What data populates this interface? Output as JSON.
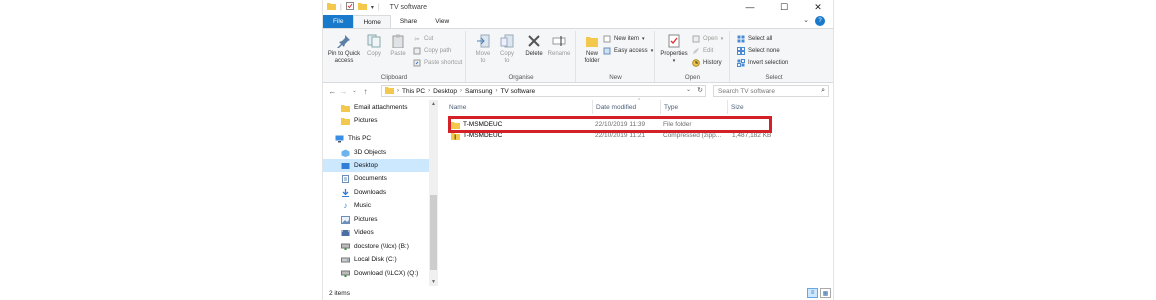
{
  "window": {
    "title": "TV software",
    "controls": {
      "minimize": "—",
      "maximize": "☐",
      "close": "✕"
    }
  },
  "ribbon_tabs": [
    "File",
    "Home",
    "Share",
    "View"
  ],
  "ribbon": {
    "clipboard": {
      "label": "Clipboard",
      "pin": "Pin to Quick access",
      "copy": "Copy",
      "paste": "Paste",
      "cut": "Cut",
      "copy_path": "Copy path",
      "paste_shortcut": "Paste shortcut"
    },
    "organise": {
      "label": "Organise",
      "move_to": "Move to",
      "copy_to": "Copy to",
      "delete": "Delete",
      "rename": "Rename"
    },
    "new": {
      "label": "New",
      "new_folder": "New folder",
      "new_item": "New item",
      "easy_access": "Easy access"
    },
    "open": {
      "label": "Open",
      "properties": "Properties",
      "open": "Open",
      "edit": "Edit",
      "history": "History"
    },
    "select": {
      "label": "Select",
      "select_all": "Select all",
      "select_none": "Select none",
      "invert_selection": "Invert selection"
    }
  },
  "address": {
    "crumbs": [
      "This PC",
      "Desktop",
      "Samsung",
      "TV software"
    ],
    "search_placeholder": "Search TV software"
  },
  "nav_pane": {
    "items": [
      {
        "label": "Email attachments",
        "icon": "folder-icon"
      },
      {
        "label": "Pictures",
        "icon": "folder-icon"
      },
      {
        "label": "This PC",
        "icon": "computer-icon"
      },
      {
        "label": "3D Objects",
        "icon": "3d-objects-icon"
      },
      {
        "label": "Desktop",
        "icon": "desktop-icon"
      },
      {
        "label": "Documents",
        "icon": "documents-icon"
      },
      {
        "label": "Downloads",
        "icon": "downloads-icon"
      },
      {
        "label": "Music",
        "icon": "music-icon"
      },
      {
        "label": "Pictures",
        "icon": "pictures-icon"
      },
      {
        "label": "Videos",
        "icon": "videos-icon"
      },
      {
        "label": "docstore (\\\\lcx) (B:)",
        "icon": "network-drive-icon"
      },
      {
        "label": "Local Disk (C:)",
        "icon": "disk-icon"
      },
      {
        "label": "Download (\\\\LCX) (Q:)",
        "icon": "network-drive-icon"
      }
    ],
    "selected": "Desktop"
  },
  "file_list": {
    "columns": [
      "Name",
      "Date modified",
      "Type",
      "Size"
    ],
    "rows": [
      {
        "name": "T-MSMDEUC",
        "date": "22/10/2019 11:39",
        "type": "File folder",
        "size": ""
      },
      {
        "name": "T-MSMDEUC",
        "date": "22/10/2019 11:21",
        "type": "Compressed (zipp...",
        "size": "1,487,182 KB"
      }
    ]
  },
  "status": {
    "item_count": "2 items"
  },
  "colors": {
    "accent": "#1979ca",
    "highlight_box": "#d42027",
    "selection": "#cce8ff"
  }
}
